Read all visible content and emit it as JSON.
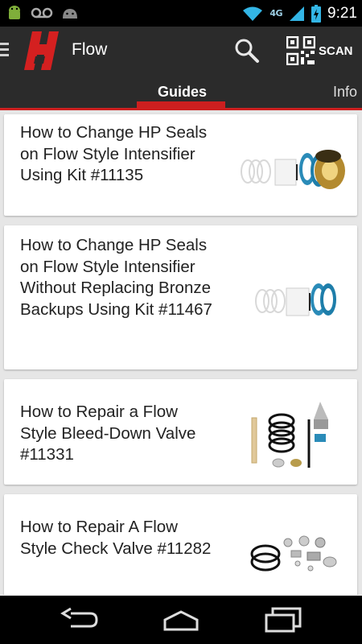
{
  "status_bar": {
    "time": "9:21",
    "network_label": "4G",
    "icons": [
      "android-icon",
      "voicemail-icon",
      "android-icon",
      "wifi-icon",
      "signal-icon",
      "battery-icon"
    ]
  },
  "action_bar": {
    "title": "Flow",
    "scan_label": "SCAN",
    "brand_color": "#cc1f1f"
  },
  "tabs": [
    {
      "label": "Guides",
      "selected": true
    },
    {
      "label": "Info",
      "selected": false
    }
  ],
  "guides": [
    {
      "title": "How to Change HP Seals on Flow Style Intensifier Using Kit #11135",
      "thumb": "seal-kit-with-bronze"
    },
    {
      "title": "How to Change HP Seals on Flow Style Intensifier Without Replacing Bronze Backups Using Kit #11467",
      "thumb": "seal-kit"
    },
    {
      "title": "How to Repair a Flow Style Bleed-Down Valve #11331",
      "thumb": "bleed-down-valve-kit"
    },
    {
      "title": "How to Repair A Flow Style Check Valve #11282",
      "thumb": "check-valve-kit"
    }
  ],
  "nav_bar": {
    "icons": [
      "back-icon",
      "home-icon",
      "recent-apps-icon"
    ]
  }
}
